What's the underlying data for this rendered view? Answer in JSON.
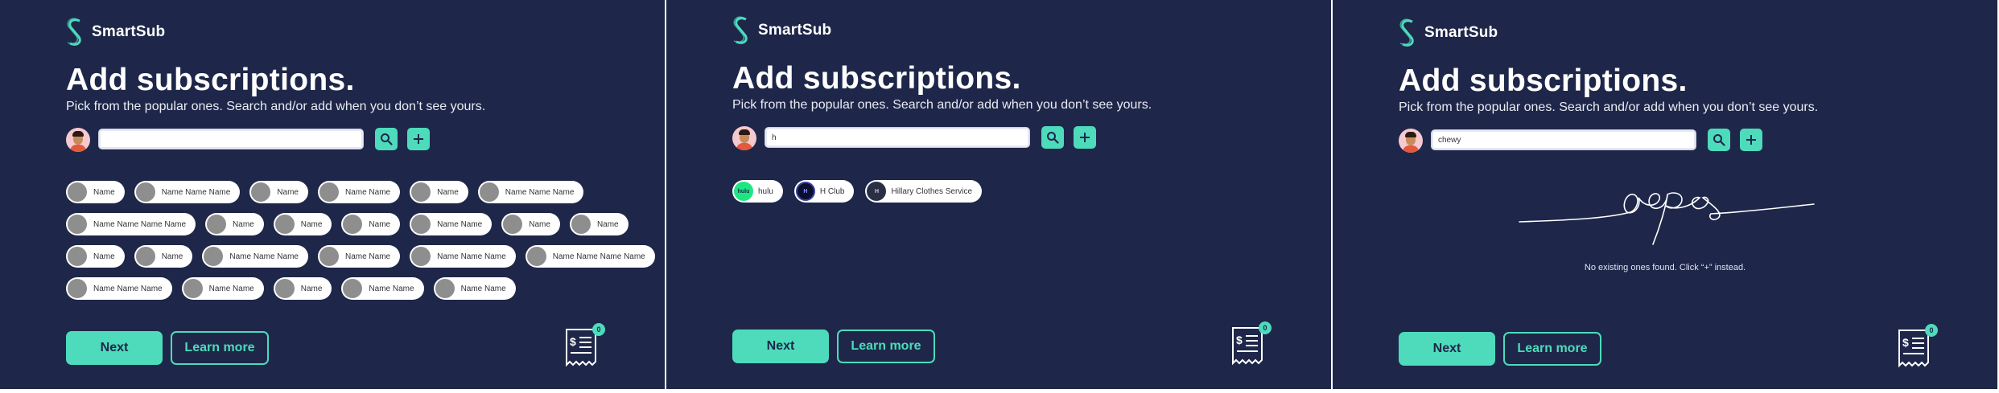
{
  "brand": {
    "name": "SmartSub"
  },
  "page": {
    "title": "Add subscriptions.",
    "subtitle": "Pick from the popular ones. Search and/or add when you don’t see yours."
  },
  "buttons": {
    "next": "Next",
    "learn_more": "Learn more"
  },
  "icons": {
    "search": "magnifier-icon",
    "add": "plus-icon",
    "receipt": "receipt-icon"
  },
  "colors": {
    "background": "#1e2749",
    "accent": "#4ddbbc"
  },
  "panels": [
    {
      "search_value": "",
      "cart_count": "0",
      "chip_rows": [
        [
          "Name",
          "Name Name Name",
          "Name",
          "Name Name",
          "Name",
          "Name Name Name"
        ],
        [
          "Name Name Name Name",
          "Name",
          "Name",
          "Name",
          "Name Name",
          "Name",
          "Name"
        ],
        [
          "Name",
          "Name",
          "Name Name Name",
          "Name Name",
          "Name Name Name",
          "Name Name Name Name"
        ],
        [
          "Name Name Name",
          "Name Name",
          "Name",
          "Name Name",
          "Name Name"
        ]
      ]
    },
    {
      "search_value": "h",
      "cart_count": "0",
      "results": [
        {
          "label": "hulu",
          "logo_text": "hulu"
        },
        {
          "label": "H Club",
          "logo_text": "H"
        },
        {
          "label": "Hillary Clothes Service",
          "logo_text": "H"
        }
      ]
    },
    {
      "search_value": "chewy",
      "cart_count": "0",
      "empty_message": "No existing ones found. Click “+” instead."
    }
  ]
}
